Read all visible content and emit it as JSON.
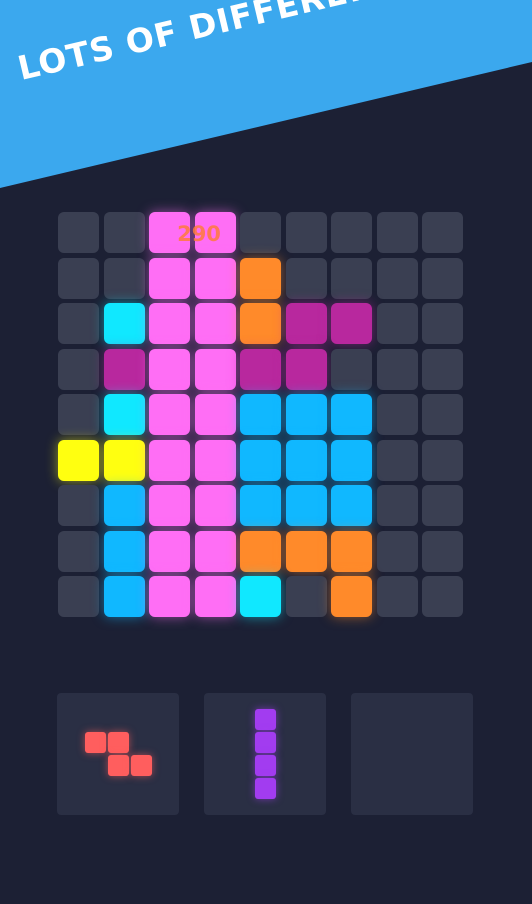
{
  "banner": {
    "text": "LOTS OF DIFFERENT THEME"
  },
  "score": "290",
  "colors": {
    "empty": "#3a3f52",
    "M": "#ff6ef5",
    "O": "#ff8a2a",
    "C": "#10e8ff",
    "P": "#b8289e",
    "B": "#10b8ff",
    "Y": "#ffff10",
    "piece_red": "#ff5e5e",
    "piece_purple": "#a23cf0"
  },
  "board": {
    "rows": [
      "..MM.....",
      "..MMO....",
      ".CMMOPP..",
      ".PMMPP...",
      ".CMMBBB..",
      "YYMMBBB..",
      ".BMMBBB..",
      ".BMMOOO..",
      ".BMMC.O.."
    ]
  },
  "tray": {
    "slots": [
      {
        "name": "z-piece",
        "color": "piece_red",
        "cells": [
          [
            0,
            0
          ],
          [
            0,
            1
          ],
          [
            1,
            1
          ],
          [
            1,
            2
          ]
        ]
      },
      {
        "name": "i-piece",
        "color": "piece_purple",
        "cells": [
          [
            0,
            0
          ],
          [
            1,
            0
          ],
          [
            2,
            0
          ],
          [
            3,
            0
          ]
        ]
      },
      {
        "name": "empty-slot",
        "color": "",
        "cells": []
      }
    ]
  }
}
